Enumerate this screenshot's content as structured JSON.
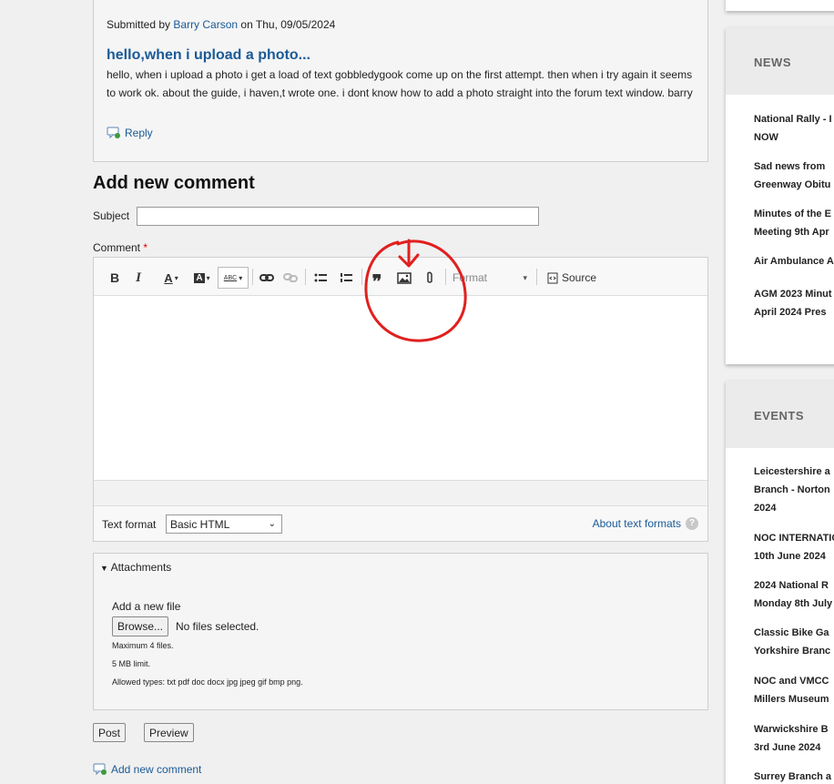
{
  "comment": {
    "submitted_prefix": "Submitted by",
    "author": "Barry Carson",
    "submitted_suffix": "on Thu, 09/05/2024",
    "title": "hello,when i upload a photo...",
    "body": "hello,     when i upload a photo i get a load of text gobbledygook come up on the first attempt. then when i try again it seems to work ok. about the guide, i haven,t wrote one. i dont know how to add a photo straight into the forum text window.  barry",
    "reply_label": "Reply"
  },
  "form": {
    "heading": "Add new comment",
    "subject_label": "Subject",
    "subject_value": "",
    "comment_label": "Comment",
    "required_marker": "*",
    "toolbar": {
      "bold": "B",
      "italic": "I",
      "text_color": "A",
      "bg_color": "A",
      "spellcheck": "ABC",
      "format_label": "Format",
      "source_label": "Source"
    },
    "text_format_label": "Text format",
    "text_format_value": "Basic HTML",
    "about_formats": "About text formats",
    "help_glyph": "?",
    "attachments": {
      "legend": "Attachments",
      "add_file_label": "Add a new file",
      "browse_label": "Browse...",
      "no_files": "No files selected.",
      "max_files": "Maximum 4 files.",
      "size_limit": "5 MB limit.",
      "allowed_types": "Allowed types: txt pdf doc docx jpg jpeg gif bmp png."
    },
    "post_label": "Post",
    "preview_label": "Preview",
    "add_comment_link": "Add new comment"
  },
  "sidebar": {
    "news_heading": "NEWS",
    "news_items": [
      {
        "line1": "National Rally - I",
        "line2": "NOW"
      },
      {
        "line1": "Sad news from",
        "line2": "Greenway Obitu"
      },
      {
        "line1": "Minutes of the E",
        "line2": "Meeting 9th Apr"
      },
      {
        "line1": "Air Ambulance A",
        "line2": ""
      },
      {
        "line1": "AGM 2023 Minut",
        "line2": "April 2024 Pres"
      }
    ],
    "events_heading": "EVENTS",
    "event_items": [
      {
        "line1": "Leicestershire a",
        "line2": "Branch - Norton",
        "line3": "2024"
      },
      {
        "line1": "NOC INTERNATIO",
        "line2": "10th June 2024"
      },
      {
        "line1": "2024 National R",
        "line2": "Monday 8th July"
      },
      {
        "line1": "Classic Bike Ga",
        "line2": "Yorkshire Branc"
      },
      {
        "line1": "NOC and VMCC",
        "line2": "Millers Museum"
      },
      {
        "line1": "Warwickshire B",
        "line2": "3rd June 2024"
      },
      {
        "line1": "Surrey Branch a",
        "line2": ""
      }
    ]
  },
  "colors": {
    "link": "#1a5a96",
    "annotation": "#e0201f",
    "required": "#dd0000"
  }
}
